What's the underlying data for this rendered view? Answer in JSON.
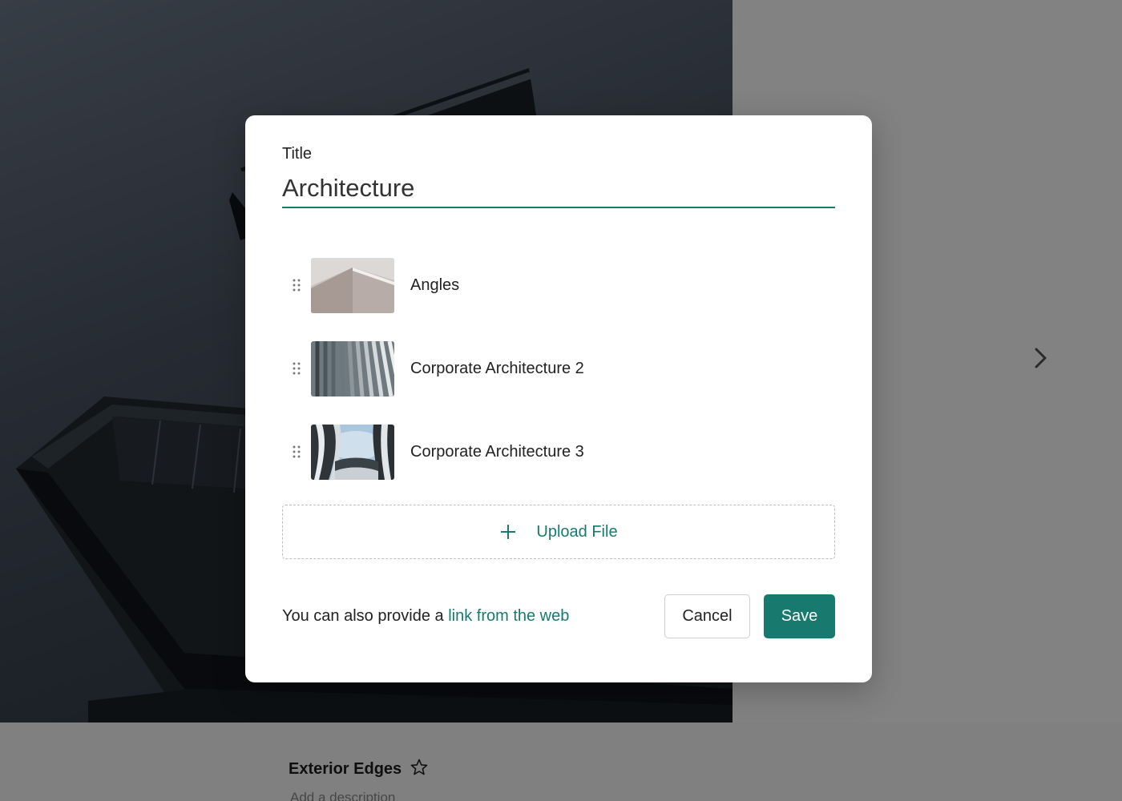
{
  "background": {
    "photo_title": "Exterior Edges",
    "photo_description": "Add a description"
  },
  "modal": {
    "title_label": "Title",
    "title_value": "Architecture",
    "files": [
      {
        "name": "Angles"
      },
      {
        "name": "Corporate Architecture 2"
      },
      {
        "name": "Corporate Architecture 3"
      }
    ],
    "upload_label": "Upload File",
    "footer_text": "You can also provide a",
    "footer_link": "link from the web",
    "cancel_label": "Cancel",
    "save_label": "Save"
  },
  "colors": {
    "accent": "#187a6f",
    "overlay": "rgba(0,0,0,0.48)"
  },
  "icons": {
    "drag": "drag-handle-icon",
    "upload": "plus-icon",
    "star": "star-outline-icon",
    "next": "chevron-right-icon"
  }
}
